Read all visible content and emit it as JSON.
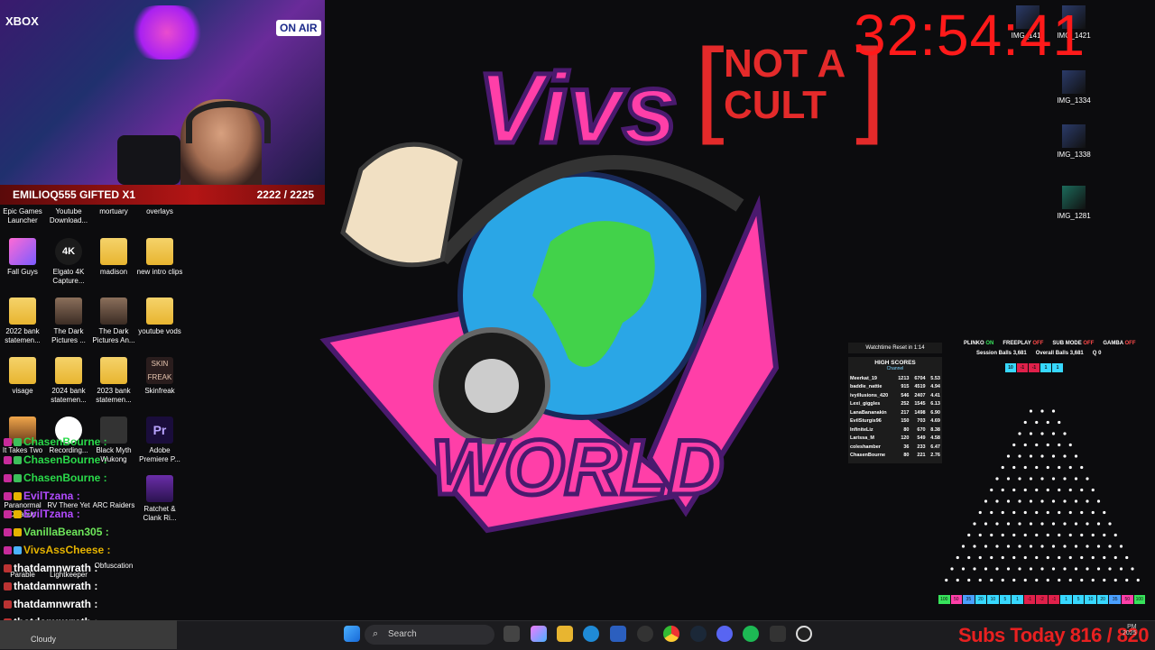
{
  "timer": "32:54:41",
  "stream": {
    "gift_text": "EMILIOQ555 GIFTED X1",
    "gift_count": "2222 / 2225",
    "logo_title": "Vivs",
    "logo_subtitle": "WORLD",
    "not_a_cult_line1": "NOT A",
    "not_a_cult_line2": "CULT",
    "bracket_left": "[",
    "bracket_right": "]",
    "webcam_onair": "ON AIR",
    "webcam_xbox": "XBOX",
    "subs_today_label": "Subs Today",
    "subs_today_value": "816 / 820"
  },
  "desktop_left": [
    {
      "label": "Epic Games Launcher"
    },
    {
      "label": "Youtube Download..."
    },
    {
      "label": "mortuary"
    },
    {
      "label": "overlays"
    },
    {
      "label": "Fall Guys"
    },
    {
      "label": "Elgato 4K Capture..."
    },
    {
      "label": "madison"
    },
    {
      "label": "new intro clips"
    },
    {
      "label": "2022 bank statemen..."
    },
    {
      "label": "The Dark Pictures ..."
    },
    {
      "label": "The Dark Pictures An..."
    },
    {
      "label": "youtube vods"
    },
    {
      "label": "visage"
    },
    {
      "label": "2024 bank statemen..."
    },
    {
      "label": "2023 bank statemen..."
    },
    {
      "label": "Skinfreak"
    },
    {
      "label": "It Takes Two"
    },
    {
      "label": "Recording..."
    },
    {
      "label": "Black Myth Wukong"
    },
    {
      "label": "Adobe Premiere P..."
    },
    {
      "label": "Paranormal Cleanup"
    },
    {
      "label": "RV There Yet"
    },
    {
      "label": "ARC Raiders"
    },
    {
      "label": "Ratchet & Clank Ri..."
    },
    {
      "label": "Parable"
    },
    {
      "label": "Lightkeeper"
    },
    {
      "label": "Obfuscation"
    }
  ],
  "desktop_right": [
    {
      "label": "IMG_1411"
    },
    {
      "label": "IMG_1421"
    },
    {
      "label": "IMG_1334"
    },
    {
      "label": "IMG_1338"
    },
    {
      "label": "IMG_1281"
    }
  ],
  "chat": [
    {
      "user": "ChasenBourne :",
      "color": "#2ad94a"
    },
    {
      "user": "ChasenBourne :",
      "color": "#2ad94a"
    },
    {
      "user": "ChasenBourne :",
      "color": "#2ad94a"
    },
    {
      "user": "EvilTzana :",
      "color": "#b24bff"
    },
    {
      "user": "EvilTzana :",
      "color": "#b24bff"
    },
    {
      "user": "VanillaBean305 :",
      "color": "#6ee75a"
    },
    {
      "user": "VivsAssCheese :",
      "color": "#e5b300"
    },
    {
      "user": "thatdamnwrath :",
      "color": "#ffffff"
    },
    {
      "user": "thatdamnwrath :",
      "color": "#ffffff"
    },
    {
      "user": "thatdamnwrath :",
      "color": "#ffffff"
    },
    {
      "user": "thatdamnwrath :",
      "color": "#ffffff"
    }
  ],
  "plinko": {
    "watchtime": "Watchtime Reset in 1:14",
    "high_scores_title": "HIGH SCORES",
    "channel_label": "Channel",
    "scores": [
      [
        "Meerkat_19",
        "1213",
        "6704",
        "5.53"
      ],
      [
        "baddie_nattie",
        "915",
        "4519",
        "4.94"
      ],
      [
        "ivyillusions_420",
        "546",
        "2407",
        "4.41"
      ],
      [
        "Lexi_giggles",
        "252",
        "1545",
        "6.13"
      ],
      [
        "LanaBananakin",
        "217",
        "1498",
        "6.90"
      ],
      [
        "EvilSturgis96",
        "150",
        "703",
        "4.69"
      ],
      [
        "InfiniteLiz",
        "80",
        "670",
        "8.38"
      ],
      [
        "Larissa_M",
        "120",
        "549",
        "4.58"
      ],
      [
        "coleshamber",
        "36",
        "233",
        "6.47"
      ],
      [
        "ChasenBourne",
        "80",
        "221",
        "2.76"
      ]
    ],
    "status": {
      "plinko_label": "PLINKO",
      "plinko_state": "ON",
      "freeplay_label": "FREEPLAY",
      "freeplay_state": "OFF",
      "submode_label": "SUB MODE",
      "submode_state": "OFF",
      "gamba_label": "GAMBA",
      "gamba_state": "OFF",
      "session_label": "Session Balls",
      "session_value": "3,681",
      "overall_label": "Overall Balls",
      "overall_value": "3,681",
      "q_label": "Q",
      "q_value": "0"
    },
    "top_buckets": [
      "10",
      "-1",
      "-1",
      "1",
      "1"
    ],
    "bottom_buckets": [
      "100",
      "50",
      "35",
      "20",
      "10",
      "5",
      "1",
      "-1",
      "-2",
      "-1",
      "1",
      "5",
      "10",
      "20",
      "35",
      "50",
      "100"
    ]
  },
  "taskbar": {
    "weather": "Cloudy",
    "search_placeholder": "Search",
    "time": "PM",
    "date": "2025"
  }
}
